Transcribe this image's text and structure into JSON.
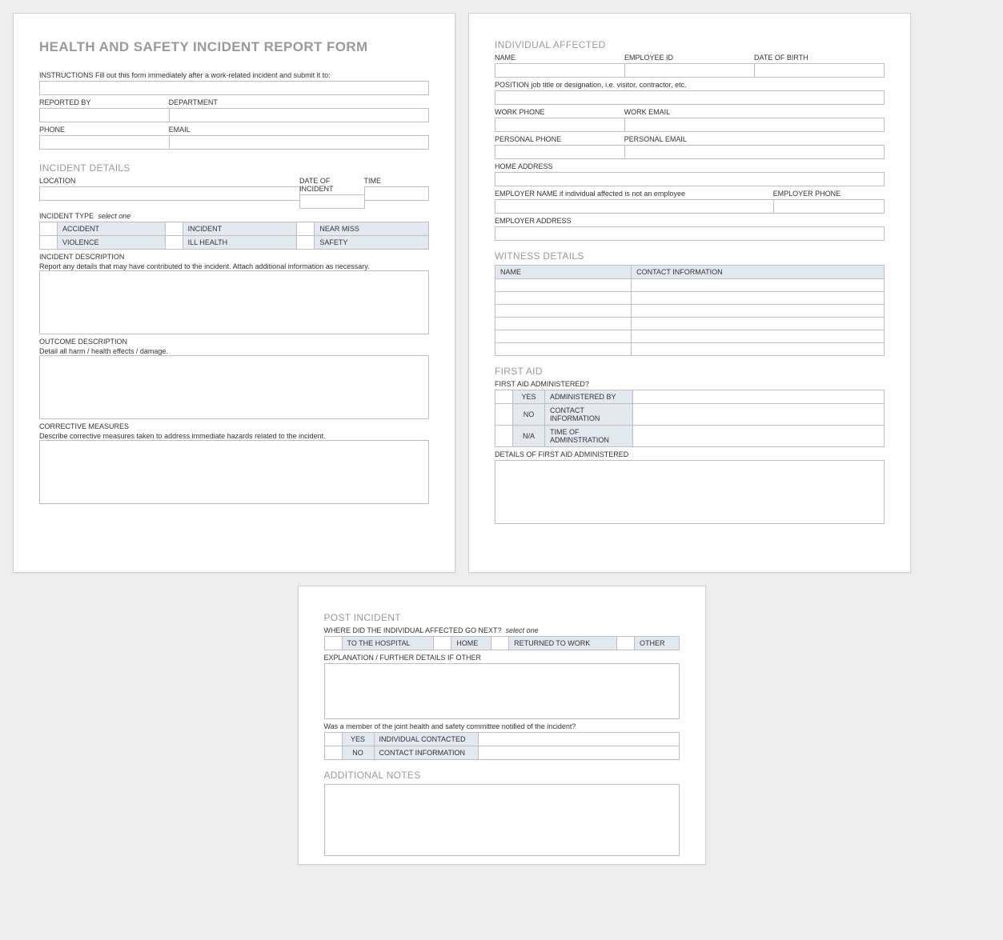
{
  "page1": {
    "title": "HEALTH AND SAFETY INCIDENT REPORT FORM",
    "instructions_label": "INSTRUCTIONS  Fill out this form immediately after a work-related incident and submit it to:",
    "reported_by_label": "REPORTED BY",
    "department_label": "DEPARTMENT",
    "phone_label": "PHONE",
    "email_label": "EMAIL",
    "incident_details_header": "INCIDENT DETAILS",
    "location_label": "LOCATION",
    "date_of_incident_label": "DATE OF INCIDENT",
    "time_label": "TIME",
    "incident_type_label": "INCIDENT TYPE",
    "incident_type_hint": "select one",
    "incident_types": [
      "ACCIDENT",
      "INCIDENT",
      "NEAR MISS",
      "VIOLENCE",
      "ILL HEALTH",
      "SAFETY"
    ],
    "incident_desc_label": "INCIDENT DESCRIPTION",
    "incident_desc_sub": "Report any details that may have contributed to the incident.  Attach additional information as necessary.",
    "outcome_desc_label": "OUTCOME DESCRIPTION",
    "outcome_desc_sub": "Detail all harm / health effects / damage.",
    "corrective_label": "CORRECTIVE MEASURES",
    "corrective_sub": "Describe corrective measures taken to address immediate hazards related to the incident."
  },
  "page2": {
    "individual_header": "INDIVIDUAL AFFECTED",
    "name_label": "NAME",
    "employee_id_label": "EMPLOYEE ID",
    "dob_label": "DATE OF BIRTH",
    "position_label": "POSITION  job title or designation, i.e. visitor, contractor, etc.",
    "work_phone_label": "WORK PHONE",
    "work_email_label": "WORK EMAIL",
    "personal_phone_label": "PERSONAL PHONE",
    "personal_email_label": "PERSONAL EMAIL",
    "home_address_label": "HOME ADDRESS",
    "employer_name_label": "EMPLOYER NAME  if individual affected is not an employee",
    "employer_phone_label": "EMPLOYER PHONE",
    "employer_address_label": "EMPLOYER ADDRESS",
    "witness_header": "WITNESS DETAILS",
    "witness_name_col": "NAME",
    "witness_contact_col": "CONTACT INFORMATION",
    "first_aid_header": "FIRST AID",
    "first_aid_admin_label": "FIRST AID ADMINISTERED?",
    "yes": "YES",
    "no": "NO",
    "na": "N/A",
    "administered_by": "ADMINISTERED BY",
    "contact_info": "CONTACT INFORMATION",
    "time_admin": "TIME OF ADMINSTRATION",
    "details_first_aid": "DETAILS OF FIRST AID ADMINISTERED"
  },
  "page3": {
    "post_incident_header": "POST INCIDENT",
    "where_next_label": "WHERE DID THE INDIVIDUAL AFFECTED GO NEXT?",
    "where_next_hint": "select one",
    "where_options": [
      "TO THE HOSPITAL",
      "HOME",
      "RETURNED TO WORK",
      "OTHER"
    ],
    "explanation_label": "EXPLANATION / FURTHER DETAILS IF OTHER",
    "committee_q": "Was a member of the joint health and safety committee notified of the incident?",
    "yes": "YES",
    "no": "NO",
    "individual_contacted": "INDIVIDUAL CONTACTED",
    "contact_info": "CONTACT INFORMATION",
    "additional_notes_header": "ADDITIONAL NOTES"
  }
}
